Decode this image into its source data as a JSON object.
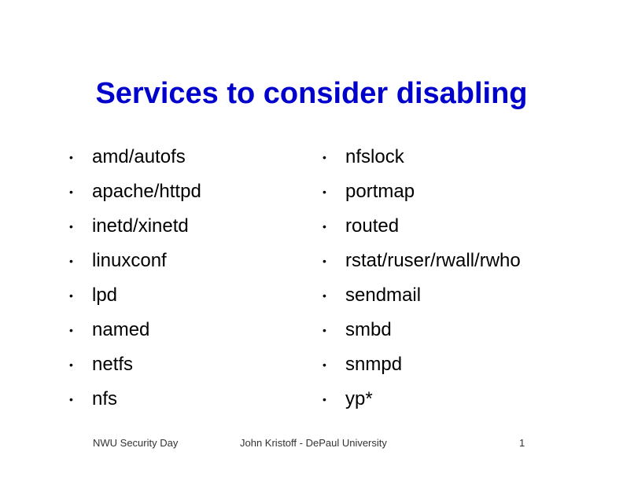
{
  "slide": {
    "title": "Services to consider disabling",
    "title_color": "#0000cc",
    "bullet_glyph": "•",
    "left_column": [
      "amd/autofs",
      "apache/httpd",
      "inetd/xinetd",
      "linuxconf",
      "lpd",
      "named",
      "netfs",
      "nfs"
    ],
    "right_column": [
      "nfslock",
      "portmap",
      "routed",
      "rstat/ruser/rwall/rwho",
      "sendmail",
      "smbd",
      "snmpd",
      "yp*"
    ]
  },
  "footer": {
    "left": "NWU Security Day",
    "center": "John Kristoff - DePaul University",
    "page_number": "1"
  }
}
